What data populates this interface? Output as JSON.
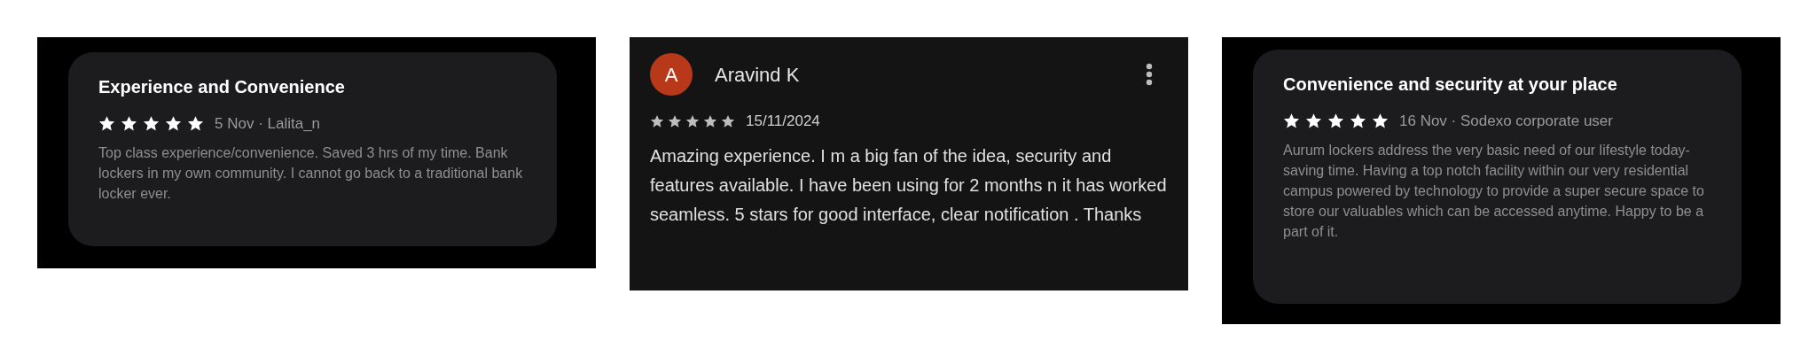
{
  "reviews": [
    {
      "kind": "card",
      "title": "Experience and Convenience",
      "stars": 5,
      "meta": "5 Nov · Lalita_n",
      "body": "Top class experience/convenience. Saved 3 hrs of my time. Bank lockers in my own community. I cannot go back to a traditional bank locker ever."
    },
    {
      "kind": "plain",
      "avatar": "A",
      "name": "Aravind K",
      "stars": 5,
      "meta": "15/11/2024",
      "body": "Amazing experience. I m a big fan of the idea, security and features available. I have been using for 2 months n it has worked seamless. 5 stars for good interface, clear notification . Thanks"
    },
    {
      "kind": "card",
      "title": "Convenience and security at your place",
      "stars": 5,
      "meta": "16 Nov · Sodexo corporate user",
      "body": "Aurum lockers address the very basic need of our lifestyle today- saving time. Having a top notch facility within our very residential campus powered by technology to provide a super secure space to store our valuables which can be accessed anytime. Happy to be a part of it."
    }
  ]
}
